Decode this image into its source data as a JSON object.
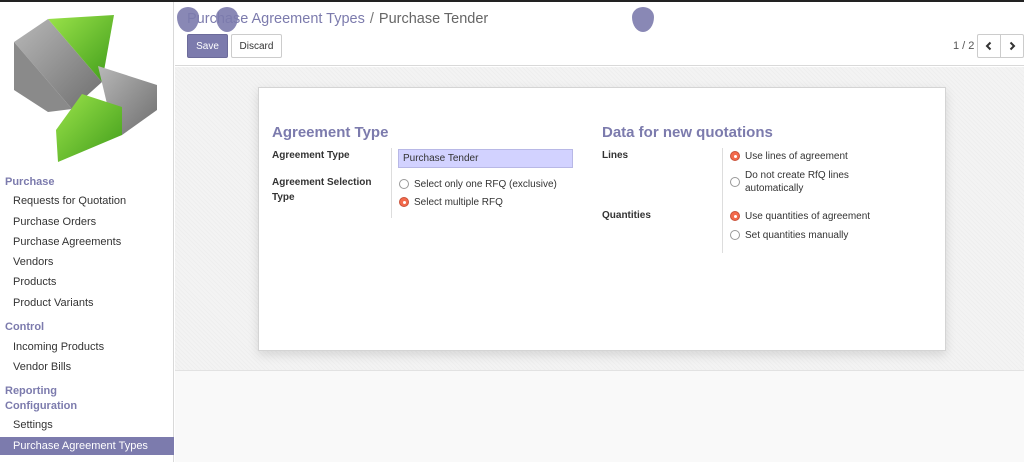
{
  "sidebar": {
    "sections": [
      {
        "label": "Purchase",
        "items": [
          "Requests for Quotation",
          "Purchase Orders",
          "Purchase Agreements",
          "Vendors",
          "Products",
          "Product Variants"
        ]
      },
      {
        "label": "Control",
        "items": [
          "Incoming Products",
          "Vendor Bills"
        ]
      },
      {
        "label": "Reporting",
        "items": []
      },
      {
        "label": "Configuration",
        "items": [
          "Settings",
          "Purchase Agreement Types"
        ]
      }
    ],
    "active_item": "Purchase Agreement Types"
  },
  "breadcrumb": {
    "parent": "Purchase Agreement Types",
    "separator": "/",
    "current": "Purchase Tender"
  },
  "buttons": {
    "save": "Save",
    "discard": "Discard"
  },
  "pager": {
    "value": "1 / 2"
  },
  "icons": {
    "prev": "chevron-left-icon",
    "next": "chevron-right-icon"
  },
  "colors": {
    "accent": "#7c7bad",
    "radio_checked": "#f36a4c",
    "input_bg": "#d2d2ff"
  },
  "form": {
    "agreement_type": {
      "title": "Agreement Type",
      "type_label": "Agreement Type",
      "type_value": "Purchase Tender",
      "selection_label": "Agreement Selection Type",
      "selection_options": [
        {
          "label": "Select only one RFQ (exclusive)",
          "checked": false
        },
        {
          "label": "Select multiple RFQ",
          "checked": true
        }
      ]
    },
    "new_quotations": {
      "title": "Data for new quotations",
      "lines_label": "Lines",
      "lines_options": [
        {
          "label": "Use lines of agreement",
          "checked": true
        },
        {
          "label": "Do not create RfQ lines automatically",
          "checked": false
        }
      ],
      "quantities_label": "Quantities",
      "quantities_options": [
        {
          "label": "Use quantities of agreement",
          "checked": true
        },
        {
          "label": "Set quantities manually",
          "checked": false
        }
      ]
    }
  }
}
